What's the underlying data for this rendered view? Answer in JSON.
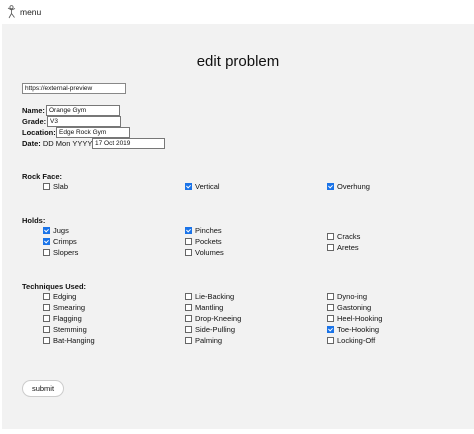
{
  "header": {
    "menu_icon": "climber-icon",
    "menu_label": "menu"
  },
  "page": {
    "title": "edit problem",
    "url_value": "https://external-preview",
    "fields": {
      "name_label": "Name:",
      "name_value": "Orange Gym",
      "grade_label": "Grade:",
      "grade_value": "V3",
      "location_label": "Location:",
      "location_value": "Edge Rock Gym",
      "date_label": "Date:",
      "date_format": "DD Mon YYYY",
      "date_value": "17 Oct 2019"
    },
    "rock_face": {
      "heading": "Rock Face:",
      "options": [
        {
          "label": "Slab",
          "checked": false
        },
        {
          "label": "Vertical",
          "checked": true
        },
        {
          "label": "Overhung",
          "checked": true
        }
      ]
    },
    "holds": {
      "heading": "Holds:",
      "options": [
        {
          "label": "Jugs",
          "checked": true
        },
        {
          "label": "Crimps",
          "checked": true
        },
        {
          "label": "Slopers",
          "checked": false
        },
        {
          "label": "Pinches",
          "checked": true
        },
        {
          "label": "Pockets",
          "checked": false
        },
        {
          "label": "Volumes",
          "checked": false
        },
        {
          "label": "Cracks",
          "checked": false
        },
        {
          "label": "Aretes",
          "checked": false
        }
      ]
    },
    "techniques": {
      "heading": "Techniques Used:",
      "options": [
        {
          "label": "Edging",
          "checked": false
        },
        {
          "label": "Smearing",
          "checked": false
        },
        {
          "label": "Flagging",
          "checked": false
        },
        {
          "label": "Stemming",
          "checked": false
        },
        {
          "label": "Bat-Hanging",
          "checked": false
        },
        {
          "label": "Lie-Backing",
          "checked": false
        },
        {
          "label": "Mantling",
          "checked": false
        },
        {
          "label": "Drop-Kneeing",
          "checked": false
        },
        {
          "label": "Side-Pulling",
          "checked": false
        },
        {
          "label": "Palming",
          "checked": false
        },
        {
          "label": "Dyno-ing",
          "checked": false
        },
        {
          "label": "Gastoning",
          "checked": false
        },
        {
          "label": "Heel-Hooking",
          "checked": false
        },
        {
          "label": "Toe-Hooking",
          "checked": true
        },
        {
          "label": "Locking-Off",
          "checked": false
        }
      ]
    },
    "submit_label": "submit"
  },
  "colors": {
    "panel": "#f2f2f2",
    "checkbox_checked": "#1a73e8"
  }
}
